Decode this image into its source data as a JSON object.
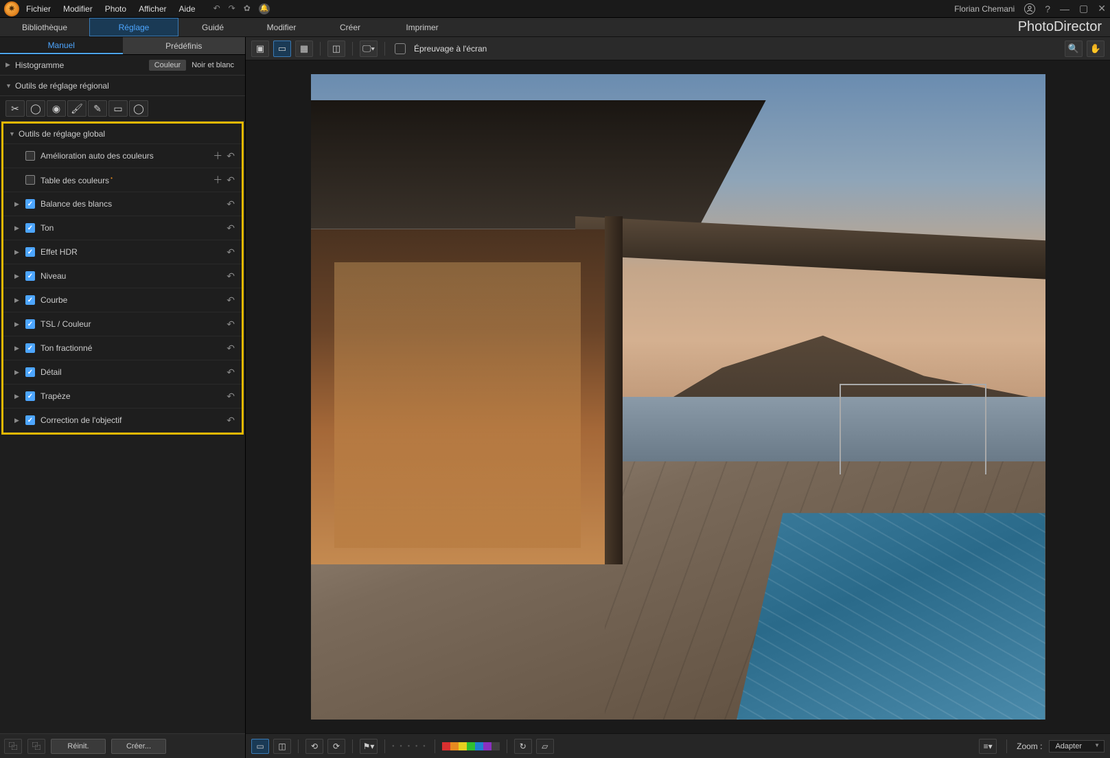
{
  "menu": {
    "file": "Fichier",
    "edit": "Modifier",
    "photo": "Photo",
    "view": "Afficher",
    "help": "Aide"
  },
  "user": "Florian Chemani",
  "brand": "PhotoDirector",
  "modules": {
    "library": "Bibliothèque",
    "adjust": "Réglage",
    "guided": "Guidé",
    "edit": "Modifier",
    "create": "Créer",
    "print": "Imprimer"
  },
  "subtabs": {
    "manual": "Manuel",
    "preset": "Prédéfinis"
  },
  "histogram": {
    "title": "Histogramme",
    "color": "Couleur",
    "bw": "Noir et blanc"
  },
  "regional": {
    "title": "Outils de réglage régional"
  },
  "global": {
    "title": "Outils de réglage global",
    "items": [
      {
        "label": "Amélioration auto des couleurs",
        "checked": false,
        "expandable": false,
        "add": true
      },
      {
        "label": "Table des couleurs",
        "checked": false,
        "expandable": false,
        "add": true,
        "dot": true
      },
      {
        "label": "Balance des blancs",
        "checked": true,
        "expandable": true
      },
      {
        "label": "Ton",
        "checked": true,
        "expandable": true
      },
      {
        "label": "Effet HDR",
        "checked": true,
        "expandable": true
      },
      {
        "label": "Niveau",
        "checked": true,
        "expandable": true
      },
      {
        "label": "Courbe",
        "checked": true,
        "expandable": true
      },
      {
        "label": "TSL / Couleur",
        "checked": true,
        "expandable": true
      },
      {
        "label": "Ton fractionné",
        "checked": true,
        "expandable": true
      },
      {
        "label": "Détail",
        "checked": true,
        "expandable": true
      },
      {
        "label": "Trapèze",
        "checked": true,
        "expandable": true
      },
      {
        "label": "Correction de l'objectif",
        "checked": true,
        "expandable": true
      }
    ]
  },
  "leftFooter": {
    "reset": "Réinit.",
    "create": "Créer..."
  },
  "viewbar": {
    "proof": "Épreuvage à l'écran"
  },
  "bottom": {
    "zoomLabel": "Zoom :",
    "zoomValue": "Adapter"
  },
  "colors": [
    "#d93030",
    "#e68a20",
    "#e6d020",
    "#30c030",
    "#2080d0",
    "#8a30c0",
    "#404040"
  ]
}
